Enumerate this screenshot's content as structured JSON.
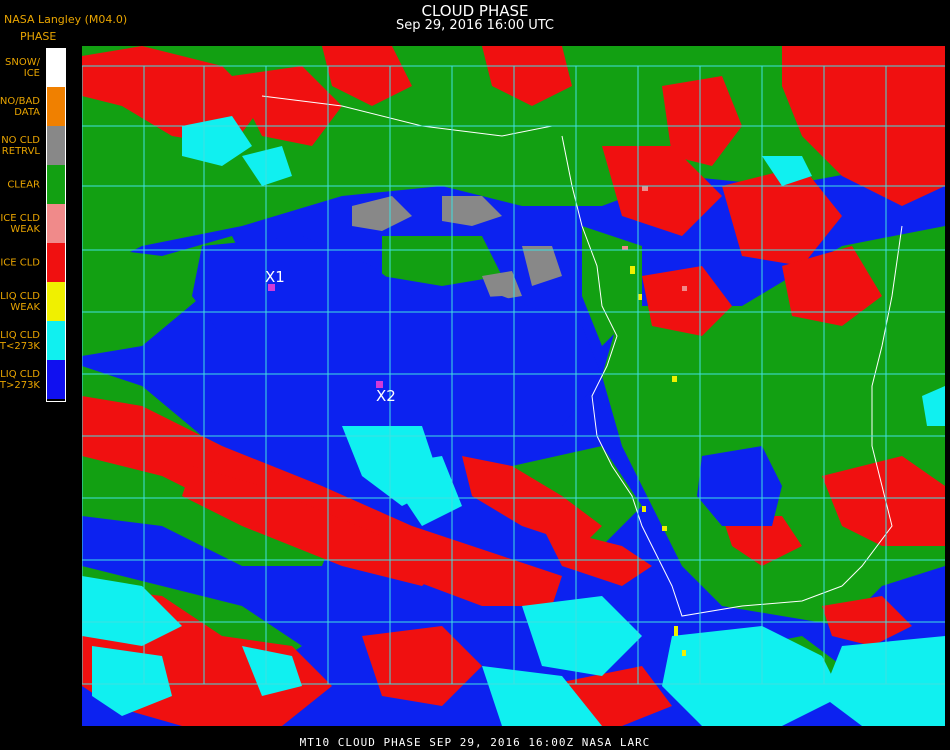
{
  "header": {
    "credit": "NASA Langley (M04.0)",
    "legend_title": "PHASE",
    "title": "CLOUD PHASE",
    "subtitle": "Sep 29, 2016 16:00 UTC"
  },
  "legend": [
    {
      "label": "SNOW/\nICE",
      "color": "#ffffff"
    },
    {
      "label": "NO/BAD\nDATA",
      "color": "#f08000"
    },
    {
      "label": "NO CLD\nRETRVL",
      "color": "#888888"
    },
    {
      "label": "CLEAR",
      "color": "#12a012"
    },
    {
      "label": "ICE CLD\nWEAK",
      "color": "#f08a8a"
    },
    {
      "label": "ICE CLD",
      "color": "#f01010"
    },
    {
      "label": "LIQ CLD\nWEAK",
      "color": "#f0f000"
    },
    {
      "label": "LIQ CLD\nT<273K",
      "color": "#10f0f0"
    },
    {
      "label": "LIQ CLD\nT>273K",
      "color": "#1010f0"
    }
  ],
  "markers": [
    {
      "label": "X1"
    },
    {
      "label": "X2"
    }
  ],
  "colors": {
    "grid": "#40e0e0",
    "coast": "#ffffff",
    "marker": "#d23ad8"
  },
  "footer": "MT10  CLOUD PHASE  SEP 29, 2016 16:00Z  NASA LARC"
}
